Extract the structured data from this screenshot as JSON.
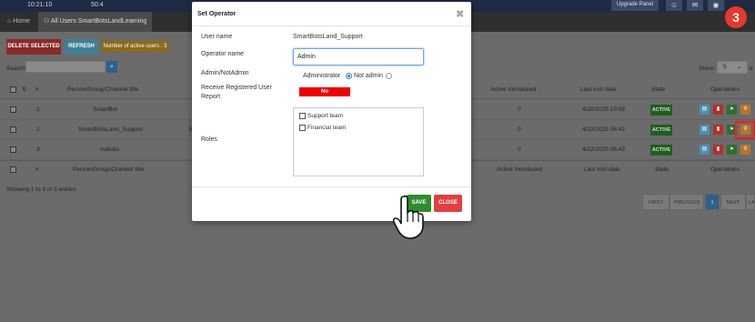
{
  "topbar": {
    "time": "10:21:10",
    "value": "50:4",
    "upgrade_label": "Upgrade Panel"
  },
  "tabs": [
    {
      "label": "Home"
    },
    {
      "label": "All Users SmartBotsLandLearning"
    }
  ],
  "toolbar": {
    "delete_label": "DELETE SELECTED",
    "refresh_label": "REFRESH",
    "active_users_label": "Number of active users : 3"
  },
  "search": {
    "label": "Search:",
    "placeholder": ""
  },
  "show": {
    "label": "Show:",
    "value": "5",
    "suffix": "e"
  },
  "table": {
    "headers": [
      "#",
      "Person/Group/Channel title",
      "Active Introduced",
      "Last visit date",
      "State",
      "Operations"
    ],
    "rows": [
      {
        "num": "1",
        "title": "SmartBot",
        "active": "0",
        "date": "4/20/2025 10:58",
        "state": "ACTIVE"
      },
      {
        "num": "2",
        "title": "SmartBotsLand_Support",
        "active": "0",
        "date": "4/22/2025 06:42",
        "state": "ACTIVE"
      },
      {
        "num": "3",
        "title": "mahdis",
        "active": "0",
        "date": "4/22/2025 06:43",
        "state": "ACTIVE"
      }
    ],
    "row2_extra": "S"
  },
  "entries_text": "Showing 1 to 3 of 3 entries",
  "pagination": {
    "first": "FIRST",
    "previous": "PREVIOUS",
    "current": "1",
    "next": "NEXT",
    "last": "LA"
  },
  "step_badge": "3",
  "modal": {
    "title": "Set Operator",
    "user_name_label": "User name",
    "user_name_value": "SmartBotsLand_Support",
    "operator_name_label": "Operator name",
    "operator_name_value": "Admin",
    "admin_label": "Admin/NotAdmin",
    "admin_option": "Administrator",
    "notadmin_option": "Not admin",
    "receive_label": "Receive Registered User Report",
    "receive_value": "No",
    "roles_label": "Roles",
    "roles": [
      {
        "label": "Support team",
        "checked": false
      },
      {
        "label": "Financial team",
        "checked": false
      }
    ],
    "save_label": "SAVE",
    "close_label": "CLOSE"
  },
  "colors": {
    "topbar": "#1f2a44",
    "active_state": "#1f5e1f",
    "save": "#2e8b2e",
    "close": "#e04040",
    "no_toggle": "#ee0000",
    "badge": "#e8382b",
    "highlight": "#ff1a1a"
  }
}
